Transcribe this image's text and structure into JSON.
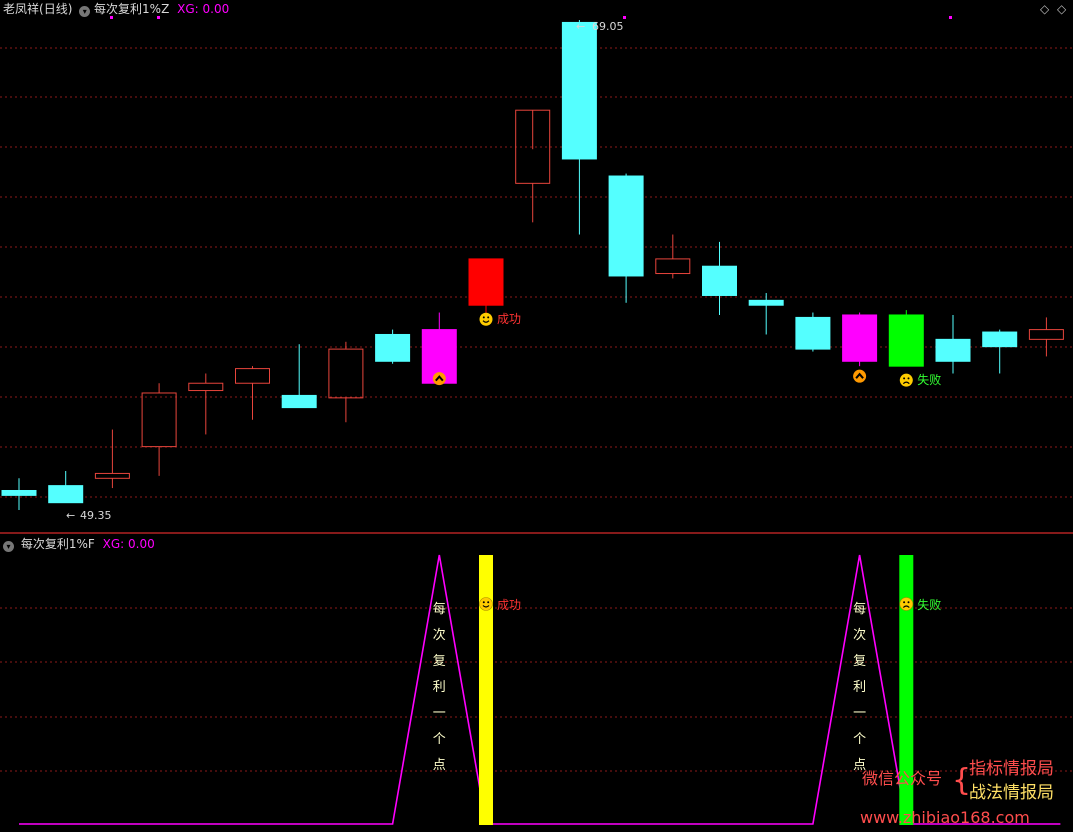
{
  "header_main": {
    "stock_name": "老凤祥",
    "period": "(日线)",
    "indicator": "每次复利1%Z",
    "xg_label": "XG:",
    "xg_value": "0.00"
  },
  "header_sub": {
    "indicator": "每次复利1%F",
    "xg_label": "XG:",
    "xg_value": "0.00"
  },
  "colors": {
    "up_outline": "#e8453c",
    "down_fill": "#54ffff",
    "signal_magenta": "#ff00ff",
    "signal_red": "#ff0000",
    "signal_green": "#00ff00",
    "signal_yellow": "#ffff00",
    "grid": "#8b1a1a",
    "success_text": "#ff3333",
    "fail_text": "#33ff33"
  },
  "chart_data": [
    {
      "type": "candlestick",
      "name": "main",
      "high_label": "69.05",
      "low_label": "49.35",
      "ohlc": [
        {
          "o": 49.8,
          "h": 50.3,
          "l": 49.0,
          "c": 49.6
        },
        {
          "o": 50.0,
          "h": 50.6,
          "l": 49.3,
          "c": 49.3
        },
        {
          "o": 50.3,
          "h": 52.3,
          "l": 49.9,
          "c": 50.5
        },
        {
          "o": 51.6,
          "h": 54.2,
          "l": 50.4,
          "c": 53.8
        },
        {
          "o": 53.9,
          "h": 54.6,
          "l": 52.1,
          "c": 54.2
        },
        {
          "o": 54.2,
          "h": 54.9,
          "l": 52.7,
          "c": 54.8
        },
        {
          "o": 53.7,
          "h": 55.8,
          "l": 53.6,
          "c": 53.2
        },
        {
          "o": 53.6,
          "h": 55.9,
          "l": 52.6,
          "c": 55.6
        },
        {
          "o": 56.2,
          "h": 56.4,
          "l": 55.0,
          "c": 55.1
        },
        {
          "o": 56.4,
          "h": 57.1,
          "l": 54.8,
          "c": 54.2
        },
        {
          "o": 57.4,
          "h": 58.8,
          "l": 57.0,
          "c": 59.3
        },
        {
          "o": 62.4,
          "h": 63.8,
          "l": 60.8,
          "c": 65.4
        },
        {
          "o": 69.0,
          "h": 69.1,
          "l": 60.3,
          "c": 63.4
        },
        {
          "o": 62.7,
          "h": 62.8,
          "l": 57.5,
          "c": 58.6
        },
        {
          "o": 58.7,
          "h": 60.3,
          "l": 58.5,
          "c": 59.3
        },
        {
          "o": 59.0,
          "h": 60.0,
          "l": 57.0,
          "c": 57.8
        },
        {
          "o": 57.6,
          "h": 57.9,
          "l": 56.2,
          "c": 57.4
        },
        {
          "o": 56.9,
          "h": 57.1,
          "l": 55.5,
          "c": 55.6
        },
        {
          "o": 57.0,
          "h": 57.1,
          "l": 54.9,
          "c": 55.1
        },
        {
          "o": 57.0,
          "h": 57.2,
          "l": 55.0,
          "c": 54.9
        },
        {
          "o": 56.0,
          "h": 57.0,
          "l": 54.6,
          "c": 55.1
        },
        {
          "o": 56.3,
          "h": 56.4,
          "l": 54.6,
          "c": 55.7
        },
        {
          "o": 56.0,
          "h": 56.9,
          "l": 55.3,
          "c": 56.4
        }
      ],
      "special_colors": {
        "9": "magenta",
        "10": "red",
        "18": "magenta",
        "19": "green"
      },
      "markers": [
        {
          "index": 9,
          "type": "up-arrow"
        },
        {
          "index": 10,
          "type": "smile",
          "label": "成功"
        },
        {
          "index": 18,
          "type": "up-arrow"
        },
        {
          "index": 19,
          "type": "frown",
          "label": "失败"
        }
      ]
    },
    {
      "type": "line",
      "name": "sub",
      "x_count": 23,
      "signal_peaks": [
        {
          "start": 8.0,
          "peak": 9.0,
          "end": 10.0
        },
        {
          "start": 17.0,
          "peak": 18.0,
          "end": 19.0
        }
      ],
      "bars": [
        {
          "index": 10,
          "color": "yellow",
          "label": "成功",
          "marker": "smile"
        },
        {
          "index": 19,
          "color": "green",
          "label": "失败",
          "marker": "frown"
        }
      ],
      "vertical_texts": [
        {
          "index": 9,
          "text": [
            "每",
            "次",
            "复",
            "利",
            "一",
            "个",
            "点"
          ]
        },
        {
          "index": 18,
          "text": [
            "每",
            "次",
            "复",
            "利",
            "一",
            "个",
            "点"
          ]
        }
      ]
    }
  ],
  "watermark": {
    "line1": "指标情报局",
    "line2": "战法情报局",
    "left": "微信公众号",
    "url": "www.zhibiao168.com"
  }
}
